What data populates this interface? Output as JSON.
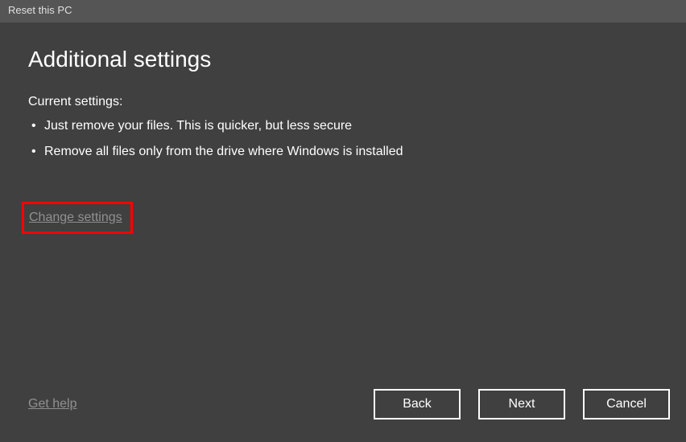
{
  "window": {
    "title": "Reset this PC"
  },
  "heading": "Additional settings",
  "subheading": "Current settings:",
  "settings": [
    "Just remove your files. This is quicker, but less secure",
    "Remove all files only from the drive where Windows is installed"
  ],
  "change_link": "Change settings",
  "help_link": "Get help",
  "buttons": {
    "back": "Back",
    "next": "Next",
    "cancel": "Cancel"
  }
}
